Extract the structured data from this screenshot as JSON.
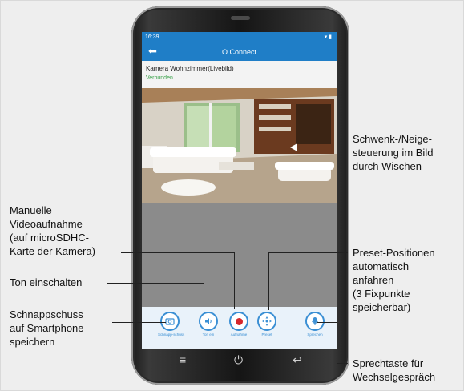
{
  "status_bar": {
    "time": "16:39",
    "icons": "▾ ▮"
  },
  "app_bar": {
    "back_icon": "back-arrow-icon",
    "title": "O.Connect"
  },
  "camera": {
    "name": "Kamera Wohnzimmer(Livebild)",
    "state": "Verbunden"
  },
  "toolbar": {
    "buttons": [
      {
        "label": "Schnapp-schuss",
        "icon": "camera-icon"
      },
      {
        "label": "Ton ein",
        "icon": "speaker-icon"
      },
      {
        "label": "Aufnahme",
        "icon": "record-icon"
      },
      {
        "label": "Preset",
        "icon": "preset-icon"
      },
      {
        "label": "Sprechen",
        "icon": "microphone-icon"
      }
    ]
  },
  "nav": {
    "menu": "≡",
    "power": "⏻",
    "back": "↩"
  },
  "callouts": {
    "pan_tilt": [
      "Schwenk-/Neige-",
      "steuerung im Bild",
      "durch Wischen"
    ],
    "manual_rec": [
      "Manuelle",
      "Videoaufnahme",
      "(auf microSDHC-",
      "Karte der Kamera)"
    ],
    "sound_on": [
      "Ton einschalten"
    ],
    "snapshot": [
      "Schnappschuss",
      "auf Smartphone",
      "speichern"
    ],
    "preset": [
      "Preset-Positionen",
      "automatisch",
      "anfahren",
      "(3 Fixpunkte",
      "speicherbar)"
    ],
    "talk": [
      "Sprechtaste für",
      "Wechselgespräch"
    ]
  },
  "colors": {
    "accent": "#1f7ec7",
    "connected": "#3aa24a",
    "record": "#d6262b"
  }
}
